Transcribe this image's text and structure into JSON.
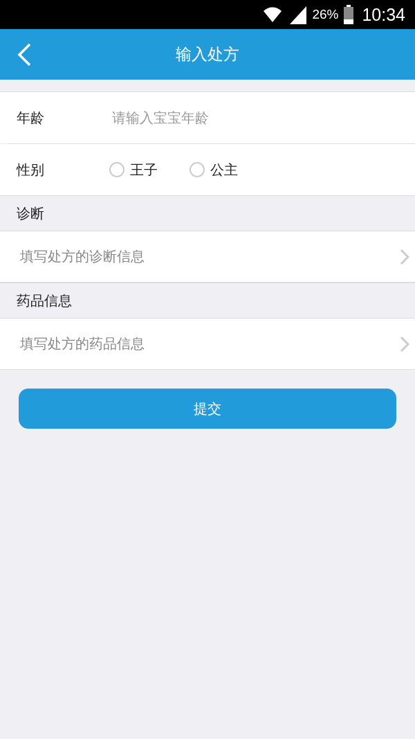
{
  "status_bar": {
    "battery": "26%",
    "time": "10:34"
  },
  "header": {
    "title": "输入处方"
  },
  "age": {
    "label": "年龄",
    "placeholder": "请输入宝宝年龄"
  },
  "gender": {
    "label": "性别",
    "options": [
      {
        "label": "王子",
        "selected": false
      },
      {
        "label": "公主",
        "selected": false
      }
    ]
  },
  "sections": [
    {
      "title": "诊断",
      "placeholder": "填写处方的诊断信息"
    },
    {
      "title": "药品信息",
      "placeholder": "填写处方的药品信息"
    }
  ],
  "submit": "提交"
}
